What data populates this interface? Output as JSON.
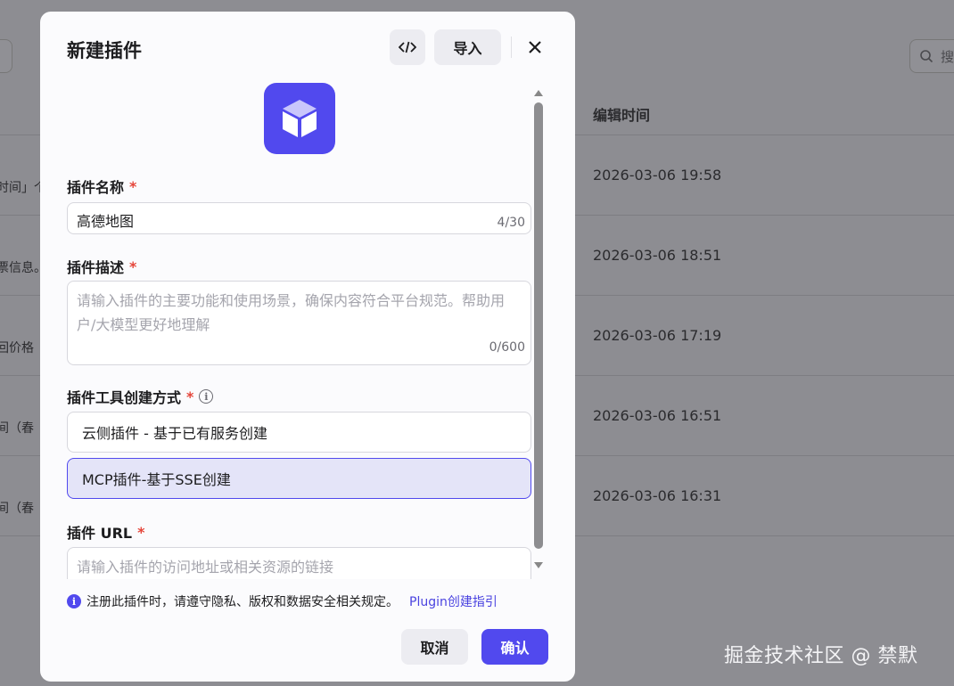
{
  "background": {
    "search_placeholder": "搜",
    "column_header": "编辑时间",
    "rows": [
      {
        "snippet": "时间」个",
        "time": "2026-03-06 19:58"
      },
      {
        "snippet": "票信息。",
        "time": "2026-03-06 18:51"
      },
      {
        "snippet": "回价格",
        "time": "2026-03-06 17:19"
      },
      {
        "snippet": "间（春",
        "time": "2026-03-06 16:51"
      },
      {
        "snippet": "间（春",
        "time": "2026-03-06 16:31"
      }
    ]
  },
  "modal": {
    "title": "新建插件",
    "code_icon": "code-icon",
    "import_label": "导入",
    "close_icon": "close-icon",
    "plugin_icon": "cube-icon",
    "name_field": {
      "label": "插件名称",
      "required": "*",
      "value": "高德地图",
      "counter": "4/30"
    },
    "desc_field": {
      "label": "插件描述",
      "required": "*",
      "placeholder": "请输入插件的主要功能和使用场景，确保内容符合平台规范。帮助用户/大模型更好地理解",
      "counter": "0/600"
    },
    "method_field": {
      "label": "插件工具创建方式",
      "required": "*",
      "options": [
        "云侧插件 - 基于已有服务创建",
        "MCP插件-基于SSE创建"
      ],
      "selected_index": 1
    },
    "url_field": {
      "label": "插件 URL",
      "required": "*",
      "placeholder": "请输入插件的访问地址或相关资源的链接"
    },
    "notice": {
      "text": "注册此插件时，请遵守隐私、版权和数据安全相关规定。",
      "link": "Plugin创建指引"
    },
    "cancel_label": "取消",
    "confirm_label": "确认"
  },
  "watermark": "掘金技术社区 @ 禁默",
  "colors": {
    "accent": "#5149ee",
    "required": "#e5453a",
    "overlay": "#8d8d92"
  }
}
